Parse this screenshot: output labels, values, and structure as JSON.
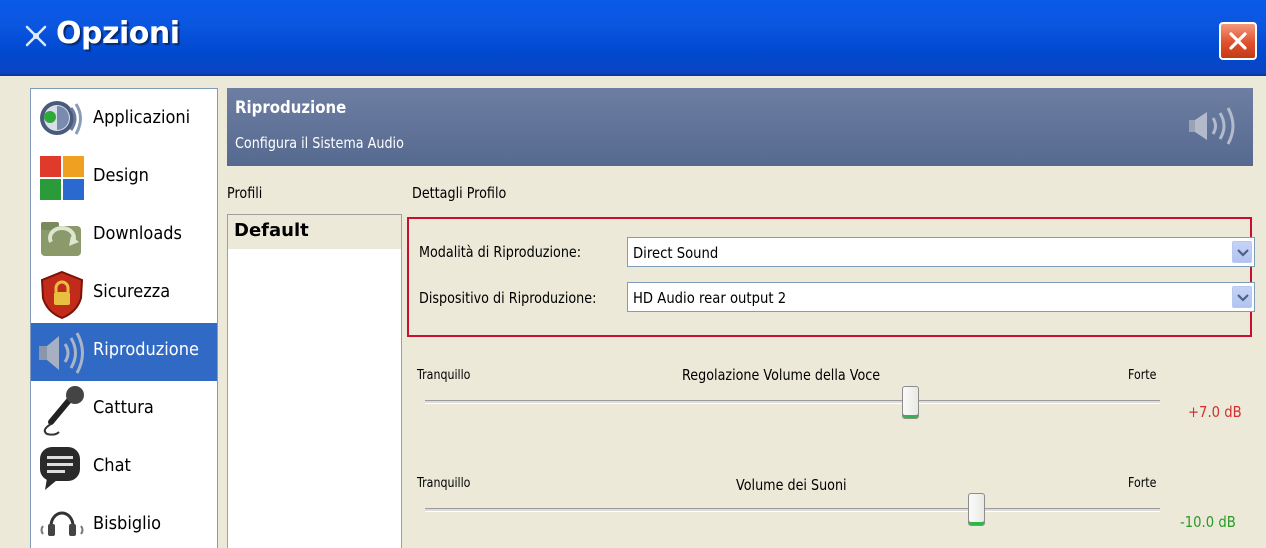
{
  "window": {
    "title": "Opzioni"
  },
  "sidebar": {
    "items": [
      {
        "label": "Applicazioni",
        "icon": "applications-icon"
      },
      {
        "label": "Design",
        "icon": "design-icon"
      },
      {
        "label": "Downloads",
        "icon": "downloads-icon"
      },
      {
        "label": "Sicurezza",
        "icon": "security-icon"
      },
      {
        "label": "Riproduzione",
        "icon": "playback-speaker-icon",
        "selected": true
      },
      {
        "label": "Cattura",
        "icon": "microphone-icon"
      },
      {
        "label": "Chat",
        "icon": "chat-icon"
      },
      {
        "label": "Bisbiglio",
        "icon": "whisper-headset-icon"
      }
    ]
  },
  "header": {
    "title": "Riproduzione",
    "subtitle": "Configura il Sistema Audio"
  },
  "profiles": {
    "label": "Profili",
    "items": [
      "Default"
    ],
    "selected": "Default"
  },
  "details": {
    "label": "Dettagli Profilo",
    "mode_label": "Modalità di Riproduzione:",
    "mode_value": "Direct Sound",
    "device_label": "Dispositivo di Riproduzione:",
    "device_value": "HD Audio rear output 2"
  },
  "voice_volume": {
    "title": "Regolazione Volume della Voce",
    "min_label": "Tranquillo",
    "max_label": "Forte",
    "value_text": "+7.0 dB",
    "value_color": "#d03030",
    "position": 0.66
  },
  "sound_volume": {
    "title": "Volume dei Suoni",
    "min_label": "Tranquillo",
    "max_label": "Forte",
    "value_text": "-10.0 dB",
    "value_color": "#2a9a2a",
    "position": 0.75
  },
  "colors": {
    "highlight_border": "#c8102e",
    "selected_bg": "#316ac5",
    "header_bg": "#5f7196"
  }
}
